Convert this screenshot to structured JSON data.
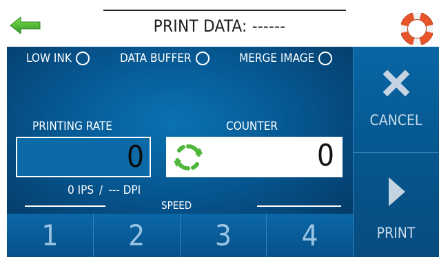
{
  "header": {
    "title": "PRINT DATA: ------",
    "back_icon": "back-arrow-icon",
    "help_icon": "lifebuoy-help-icon"
  },
  "status": [
    {
      "label": "LOW INK"
    },
    {
      "label": "DATA BUFFER"
    },
    {
      "label": "MERGE IMAGE"
    }
  ],
  "printing_rate": {
    "label": "PRINTING RATE",
    "value": "0",
    "ips": "0 IPS",
    "separator": "/",
    "dpi": "--- DPI"
  },
  "counter": {
    "label": "COUNTER",
    "value": "0",
    "reset_icon": "refresh-icon"
  },
  "speed": {
    "label": "SPEED",
    "buttons": [
      "1",
      "2",
      "3",
      "4"
    ]
  },
  "actions": {
    "cancel": "CANCEL",
    "print": "PRINT"
  },
  "colors": {
    "panel": "#06548d",
    "accent_green": "#4fb83a",
    "help_orange": "#e8542a"
  }
}
